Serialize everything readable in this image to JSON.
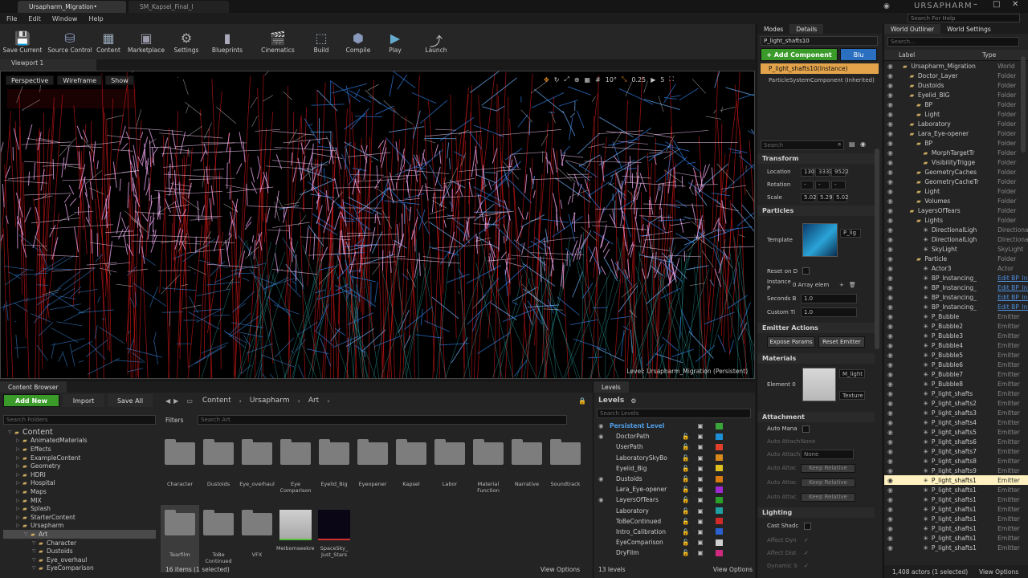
{
  "titlebar": {
    "tabs": [
      "Ursapharm_Migration•",
      "SM_Kapsel_Final_l"
    ],
    "product": "URSAPHARM",
    "help_placeholder": "Search For Help"
  },
  "menu": [
    "File",
    "Edit",
    "Window",
    "Help"
  ],
  "toolbar": [
    "Save Current",
    "Source Control",
    "Content",
    "Marketplace",
    "Settings",
    "Blueprints",
    "Cinematics",
    "Build",
    "Compile",
    "Play",
    "Launch"
  ],
  "viewport": {
    "tab": "Viewport 1",
    "buttons": [
      "Perspective",
      "Wireframe",
      "Show"
    ],
    "snap_values": [
      "10°",
      "0.25",
      "5"
    ],
    "level_label": "Level: Ursapharm_Migration (Persistent)"
  },
  "modes": {
    "tab": "Modes",
    "details_tab": "Details",
    "actor_name": "P_light_shafts10",
    "add_component": "+ Add Component",
    "blueprint": "Blu",
    "instance": "P_light_shafts10(Instance)",
    "component": "ParticleSystemComponent (Inherited)",
    "search_placeholder": "Search",
    "transform": {
      "title": "Transform",
      "location_label": "Location",
      "location": [
        "130l",
        "3337",
        "9522"
      ],
      "rotation_label": "Rotation",
      "rotation": [
        "-",
        "-",
        "-"
      ],
      "scale_label": "Scale",
      "scale": [
        "5.02",
        "5.29",
        "5.02"
      ]
    },
    "particles": {
      "title": "Particles",
      "template_label": "Template",
      "template_value": "P_lig",
      "reset_label": "Reset on D",
      "instance_label": "Instance P",
      "instance_value": "0 Array elem",
      "seconds_label": "Seconds B",
      "seconds_value": "1.0",
      "custom_label": "Custom Ti",
      "custom_value": "1.0"
    },
    "emitter": {
      "title": "Emitter Actions",
      "expose": "Expose Params",
      "reset": "Reset Emitter"
    },
    "materials": {
      "title": "Materials",
      "element": "Element 0",
      "mat": "M_light",
      "tex": "Texture"
    },
    "attachment": {
      "title": "Attachment",
      "auto_manage": "Auto Mana",
      "auto_attach1": "Auto Attach",
      "auto_attach1_value": "None",
      "auto_attach2": "Auto Attach",
      "auto_attach2_value": "None",
      "auto_attach3": "Auto Attac",
      "auto_attach3_value": "Keep Relative",
      "auto_attach4": "Auto Attac",
      "auto_attach4_value": "Keep Relative",
      "auto_attach5": "Auto Attac",
      "auto_attach5_value": "Keep Relative"
    },
    "lighting": {
      "title": "Lighting",
      "cast_shadow": "Cast Shadc",
      "affect_dyn": "Affect Dyn",
      "affect_dist": "Affect Dist",
      "dynamic": "Dynamic S"
    }
  },
  "outliner": {
    "tab": "World Outliner",
    "settings_tab": "World Settings",
    "search_placeholder": "Search...",
    "col_label": "Label",
    "col_type": "Type",
    "footer": "1,408 actors (1 selected)",
    "view_options": "View Options",
    "items": [
      {
        "indent": 0,
        "label": "Ursapharm_Migration",
        "type": "World"
      },
      {
        "indent": 1,
        "label": "Doctor_Layer",
        "type": "Folder"
      },
      {
        "indent": 1,
        "label": "Dustoids",
        "type": "Folder"
      },
      {
        "indent": 1,
        "label": "Eyelid_BIG",
        "type": "Folder"
      },
      {
        "indent": 2,
        "label": "BP",
        "type": "Folder"
      },
      {
        "indent": 2,
        "label": "Light",
        "type": "Folder"
      },
      {
        "indent": 1,
        "label": "Laboratory",
        "type": "Folder"
      },
      {
        "indent": 1,
        "label": "Lara_Eye-opener",
        "type": "Folder"
      },
      {
        "indent": 2,
        "label": "BP",
        "type": "Folder"
      },
      {
        "indent": 3,
        "label": "MorphTargetTr",
        "type": "Folder"
      },
      {
        "indent": 3,
        "label": "VisibilityTrigge",
        "type": "Folder"
      },
      {
        "indent": 2,
        "label": "GeometryCaches",
        "type": "Folder"
      },
      {
        "indent": 2,
        "label": "GeometryCacheTr",
        "type": "Folder"
      },
      {
        "indent": 2,
        "label": "Light",
        "type": "Folder"
      },
      {
        "indent": 2,
        "label": "Volumes",
        "type": "Folder"
      },
      {
        "indent": 1,
        "label": "LayersOfTears",
        "type": "Folder"
      },
      {
        "indent": 2,
        "label": "Lights",
        "type": "Folder"
      },
      {
        "indent": 3,
        "label": "DirectionalLigh",
        "type": "DirectionalL"
      },
      {
        "indent": 3,
        "label": "DirectionalLigh",
        "type": "DirectionalL"
      },
      {
        "indent": 3,
        "label": "SkyLight",
        "type": "SkyLight"
      },
      {
        "indent": 2,
        "label": "Particle",
        "type": "Folder"
      },
      {
        "indent": 3,
        "label": "Actor3",
        "type": "Actor"
      },
      {
        "indent": 3,
        "label": "BP_Instancing_",
        "type": "Edit BP_Ins"
      },
      {
        "indent": 3,
        "label": "BP_Instancing_",
        "type": "Edit BP_Ins"
      },
      {
        "indent": 3,
        "label": "BP_Instancing_",
        "type": "Edit BP_Ins"
      },
      {
        "indent": 3,
        "label": "BP_Instancing_",
        "type": "Edit BP_Ins"
      },
      {
        "indent": 3,
        "label": "P_Bubble",
        "type": "Emitter"
      },
      {
        "indent": 3,
        "label": "P_Bubble2",
        "type": "Emitter"
      },
      {
        "indent": 3,
        "label": "P_Bubble3",
        "type": "Emitter"
      },
      {
        "indent": 3,
        "label": "P_Bubble4",
        "type": "Emitter"
      },
      {
        "indent": 3,
        "label": "P_Bubble5",
        "type": "Emitter"
      },
      {
        "indent": 3,
        "label": "P_Bubble6",
        "type": "Emitter"
      },
      {
        "indent": 3,
        "label": "P_Bubble7",
        "type": "Emitter"
      },
      {
        "indent": 3,
        "label": "P_Bubble8",
        "type": "Emitter"
      },
      {
        "indent": 3,
        "label": "P_light_shafts",
        "type": "Emitter"
      },
      {
        "indent": 3,
        "label": "P_light_shafts2",
        "type": "Emitter"
      },
      {
        "indent": 3,
        "label": "P_light_shafts3",
        "type": "Emitter"
      },
      {
        "indent": 3,
        "label": "P_light_shafts4",
        "type": "Emitter"
      },
      {
        "indent": 3,
        "label": "P_light_shafts5",
        "type": "Emitter"
      },
      {
        "indent": 3,
        "label": "P_light_shafts6",
        "type": "Emitter"
      },
      {
        "indent": 3,
        "label": "P_light_shafts7",
        "type": "Emitter"
      },
      {
        "indent": 3,
        "label": "P_light_shafts8",
        "type": "Emitter"
      },
      {
        "indent": 3,
        "label": "P_light_shafts9",
        "type": "Emitter"
      },
      {
        "indent": 3,
        "label": "P_light_shafts1",
        "type": "Emitter",
        "selected": true
      },
      {
        "indent": 3,
        "label": "P_light_shafts1",
        "type": "Emitter"
      },
      {
        "indent": 3,
        "label": "P_light_shafts1",
        "type": "Emitter"
      },
      {
        "indent": 3,
        "label": "P_light_shafts1",
        "type": "Emitter"
      },
      {
        "indent": 3,
        "label": "P_light_shafts1",
        "type": "Emitter"
      },
      {
        "indent": 3,
        "label": "P_light_shafts1",
        "type": "Emitter"
      },
      {
        "indent": 3,
        "label": "P_light_shafts1",
        "type": "Emitter"
      },
      {
        "indent": 3,
        "label": "P_light_shafts1",
        "type": "Emitter"
      }
    ]
  },
  "content_browser": {
    "tab": "Content Browser",
    "add_new": "Add New",
    "import": "Import",
    "save_all": "Save All",
    "path": [
      "Content",
      "Ursapharm",
      "Art"
    ],
    "search_folders": "Search Folders",
    "filters": "Filters",
    "search_art": "Search Art",
    "footer": "16 items (1 selected)",
    "view_options": "View Options",
    "tree": [
      {
        "indent": 0,
        "label": "Content"
      },
      {
        "indent": 1,
        "label": "AnimatedMaterials"
      },
      {
        "indent": 1,
        "label": "Effects"
      },
      {
        "indent": 1,
        "label": "ExampleContent"
      },
      {
        "indent": 1,
        "label": "Geometry"
      },
      {
        "indent": 1,
        "label": "HDRI"
      },
      {
        "indent": 1,
        "label": "Hospital"
      },
      {
        "indent": 1,
        "label": "Maps"
      },
      {
        "indent": 1,
        "label": "MIX"
      },
      {
        "indent": 1,
        "label": "Splash"
      },
      {
        "indent": 1,
        "label": "StarterContent"
      },
      {
        "indent": 1,
        "label": "Ursapharm"
      },
      {
        "indent": 2,
        "label": "Art",
        "selected": true
      },
      {
        "indent": 3,
        "label": "Character"
      },
      {
        "indent": 3,
        "label": "Dustoids"
      },
      {
        "indent": 3,
        "label": "Eye_overhaul"
      },
      {
        "indent": 3,
        "label": "EyeComparison"
      }
    ],
    "assets_row1": [
      "Character",
      "Dustoids",
      "Eye_overhaul",
      "Eye Comparison",
      "Eyelid_Big",
      "Eyeopener",
      "Kapsel",
      "Labor",
      "Material Function",
      "Narrative",
      "Soundtrack"
    ],
    "assets_row2": [
      "Tearfilm",
      "ToBe Continued",
      "VFX",
      "Meibomseekret",
      "SpaceSky_ Just_Stars"
    ]
  },
  "levels": {
    "tab": "Levels",
    "title": "Levels",
    "search_placeholder": "Search Levels",
    "footer": "13 levels",
    "view_options": "View Options",
    "items": [
      {
        "label": "Persistent Level",
        "persistent": true,
        "color": "#3aa63a"
      },
      {
        "label": "DoctorPath",
        "color": "#1e8fd6"
      },
      {
        "label": "UserPath",
        "color": "#e0402a"
      },
      {
        "label": "LaboratorySkyBo",
        "color": "#d88a1e"
      },
      {
        "label": "Eyelid_Big",
        "color": "#e0c020"
      },
      {
        "label": "Dustoids",
        "color": "#d87a10"
      },
      {
        "label": "Lara_Eye-opener",
        "color": "#a02ad0"
      },
      {
        "label": "LayersOfTears",
        "color": "#2aa02a"
      },
      {
        "label": "Laboratory",
        "color": "#20a0a0"
      },
      {
        "label": "ToBeContinued",
        "color": "#d02a2a"
      },
      {
        "label": "Intro_Calibration",
        "color": "#2a60d0"
      },
      {
        "label": "EyeComparison",
        "color": "#d0d0d0"
      },
      {
        "label": "DryFilm",
        "color": "#d02a80"
      }
    ]
  },
  "colors": {
    "accent": "#e58a1f",
    "selected": "#fff2c0",
    "green": "#3a9a2a",
    "blue_link": "#4f8fe0"
  }
}
